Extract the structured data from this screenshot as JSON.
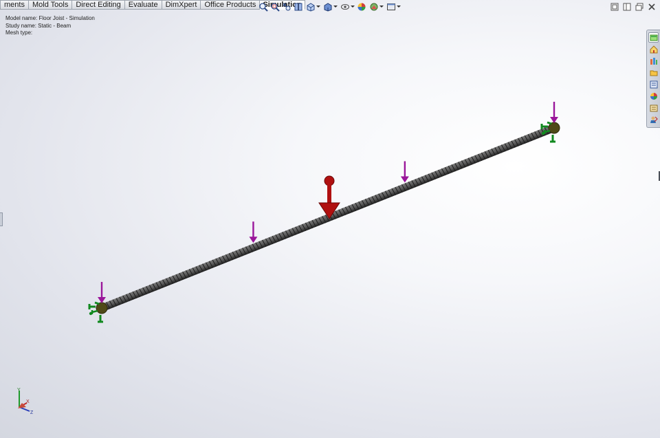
{
  "command_tabs": {
    "items": [
      {
        "label": "ments",
        "active": false
      },
      {
        "label": "Mold Tools",
        "active": false
      },
      {
        "label": "Direct Editing",
        "active": false
      },
      {
        "label": "Evaluate",
        "active": false
      },
      {
        "label": "DimXpert",
        "active": false
      },
      {
        "label": "Office Products",
        "active": false
      },
      {
        "label": "Simulation",
        "active": true
      }
    ]
  },
  "model_info": {
    "model_name_label": "Model name:",
    "model_name": "Floor Joist - Simulation",
    "study_name_label": "Study name:",
    "study_name": "Static - Beam",
    "mesh_type_label": "Mesh type:",
    "mesh_type": ""
  },
  "heads_up_toolbar": {
    "icons": [
      "zoom-to-fit-icon",
      "zoom-to-area-icon",
      "previous-view-icon",
      "section-view-icon",
      "view-orientation-icon",
      "display-style-icon",
      "hide-show-items-icon",
      "edit-appearance-icon",
      "apply-scene-icon",
      "view-settings-icon"
    ]
  },
  "window_controls": {
    "icons": [
      "tile-horizontal-icon",
      "tile-vertical-icon",
      "restore-window-icon",
      "close-window-icon"
    ]
  },
  "task_pane": {
    "icons": [
      "simulation-advisor-icon",
      "solidworks-resources-icon",
      "design-library-icon",
      "file-explorer-icon",
      "view-palette-icon",
      "appearances-scenes-icon",
      "custom-properties-icon",
      "simulation-study-advisor-icon"
    ]
  },
  "graphics_area": {
    "beam_icon": "beam-mesh-icon",
    "fixture_icon": "fixture-icon",
    "distributed_load_icon": "load-arrow-icon",
    "gravity_icon": "gravity-icon"
  },
  "triad": {
    "x_label": "X",
    "y_label": "Y",
    "z_label": "Z"
  },
  "colors": {
    "load_arrow": "#9a169a",
    "gravity": "#b01010",
    "fixture": "#11891f",
    "joint": "#4f4a18",
    "beam_dark": "#404040",
    "beam_light": "#7a7a7a"
  }
}
